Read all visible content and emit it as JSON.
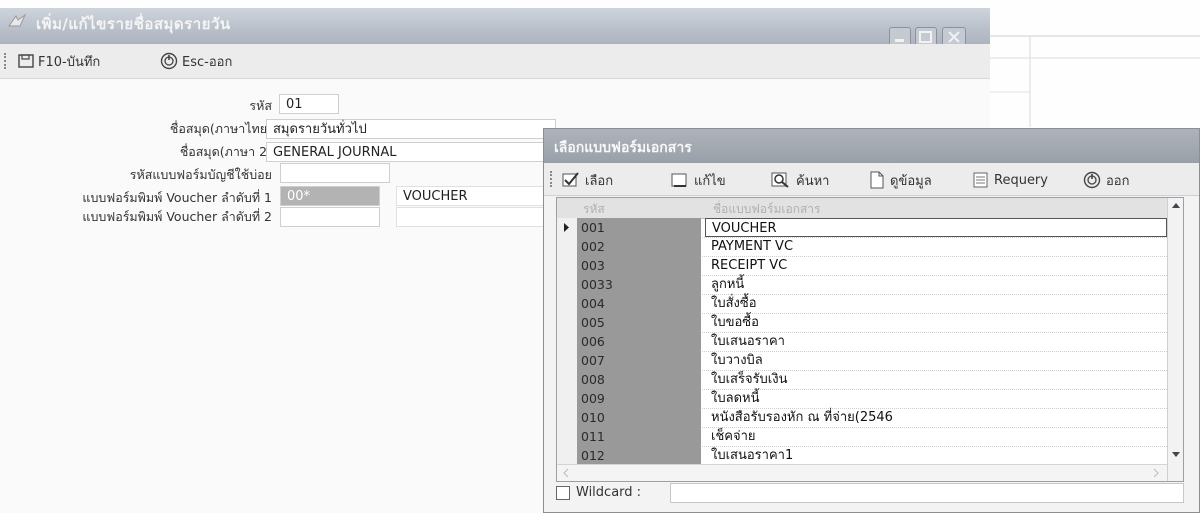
{
  "window": {
    "title": "เพิ่ม/แก้ไขรายชื่อสมุดรายวัน"
  },
  "toolbar": {
    "save_label": "F10-บันทึก",
    "exit_label": "Esc-ออก"
  },
  "form": {
    "code_label": "รหัส",
    "code_value": "01",
    "name_th_label": "ชื่อสมุด(ภาษาไทย)",
    "name_th_value": "สมุดรายวันทั่วไป",
    "name_2_label": "ชื่อสมุด(ภาษา 2)",
    "name_2_value": "GENERAL JOURNAL",
    "form_code_label": "รหัสแบบฟอร์มบัญชีใช้บ่อย",
    "form_code_value": "",
    "voucher1_label": "แบบฟอร์มพิมพ์ Voucher ลำดับที่ 1",
    "voucher1_code": "00*",
    "voucher1_name": "VOUCHER",
    "voucher2_label": "แบบฟอร์มพิมพ์ Voucher ลำดับที่ 2",
    "voucher2_code": "",
    "voucher2_name": ""
  },
  "dialog": {
    "title": "เลือกแบบฟอร์มเอกสาร",
    "toolbar": {
      "select_label": "เลือก",
      "edit_label": "แก้ไข",
      "search_label": "ค้นหา",
      "view_label": "ดูข้อมูล",
      "requery_label": "Requery",
      "exit_label": "ออก"
    },
    "columns": {
      "code": "รหัส",
      "name": "ชื่อแบบฟอร์มเอกสาร"
    },
    "rows": [
      {
        "code": "001",
        "name": "VOUCHER"
      },
      {
        "code": "002",
        "name": "PAYMENT VC"
      },
      {
        "code": "003",
        "name": "RECEIPT VC"
      },
      {
        "code": "0033",
        "name": "ลูกหนี้"
      },
      {
        "code": "004",
        "name": "ใบสั่งซื้อ"
      },
      {
        "code": "005",
        "name": "ใบขอซื้อ"
      },
      {
        "code": "006",
        "name": "ใบเสนอราคา"
      },
      {
        "code": "007",
        "name": "ใบวางบิล"
      },
      {
        "code": "008",
        "name": "ใบเสร็จรับเงิน"
      },
      {
        "code": "009",
        "name": "ใบลดหนี้"
      },
      {
        "code": "010",
        "name": "หนังสือรับรองหัก ณ ที่จ่าย(2546"
      },
      {
        "code": "011",
        "name": "เช็คจ่าย"
      },
      {
        "code": "012",
        "name": "ใบเสนอราคา1"
      }
    ],
    "wildcard_label": "Wildcard :"
  }
}
